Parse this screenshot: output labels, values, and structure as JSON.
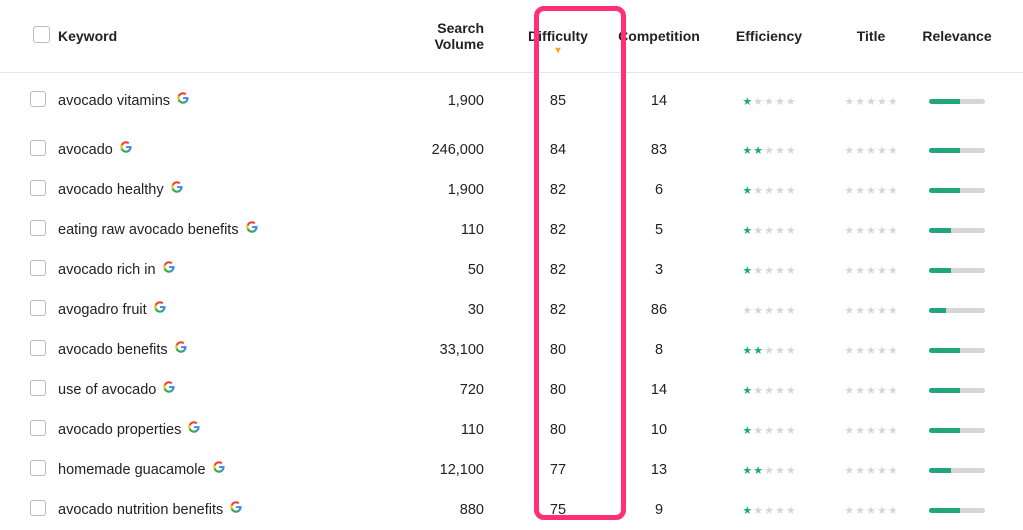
{
  "colors": {
    "accent_green": "#1fa67a",
    "highlight_pink": "#ff2f78",
    "star_off": "#d6d6d6"
  },
  "headers": {
    "keyword": "Keyword",
    "search_volume": "Search Volume",
    "difficulty": "Difficulty",
    "competition": "Competition",
    "efficiency": "Efficiency",
    "title": "Title",
    "relevance": "Relevance"
  },
  "sort": {
    "column": "difficulty",
    "direction": "desc",
    "caret": "▾"
  },
  "rows": [
    {
      "keyword": "avocado vitamins",
      "search_volume": "1,900",
      "difficulty": "85",
      "competition": "14",
      "efficiency_stars": 1,
      "title_stars": 0,
      "relevance_pct": 55
    },
    {
      "keyword": "avocado",
      "search_volume": "246,000",
      "difficulty": "84",
      "competition": "83",
      "efficiency_stars": 2,
      "title_stars": 0,
      "relevance_pct": 55
    },
    {
      "keyword": "avocado healthy",
      "search_volume": "1,900",
      "difficulty": "82",
      "competition": "6",
      "efficiency_stars": 1,
      "title_stars": 0,
      "relevance_pct": 55
    },
    {
      "keyword": "eating raw avocado benefits",
      "search_volume": "110",
      "difficulty": "82",
      "competition": "5",
      "efficiency_stars": 1,
      "title_stars": 0,
      "relevance_pct": 40
    },
    {
      "keyword": "avocado rich in",
      "search_volume": "50",
      "difficulty": "82",
      "competition": "3",
      "efficiency_stars": 1,
      "title_stars": 0,
      "relevance_pct": 40
    },
    {
      "keyword": "avogadro fruit",
      "search_volume": "30",
      "difficulty": "82",
      "competition": "86",
      "efficiency_stars": 0,
      "title_stars": 0,
      "relevance_pct": 30
    },
    {
      "keyword": "avocado benefits",
      "search_volume": "33,100",
      "difficulty": "80",
      "competition": "8",
      "efficiency_stars": 2,
      "title_stars": 0,
      "relevance_pct": 55
    },
    {
      "keyword": "use of avocado",
      "search_volume": "720",
      "difficulty": "80",
      "competition": "14",
      "efficiency_stars": 1,
      "title_stars": 0,
      "relevance_pct": 55
    },
    {
      "keyword": "avocado properties",
      "search_volume": "110",
      "difficulty": "80",
      "competition": "10",
      "efficiency_stars": 1,
      "title_stars": 0,
      "relevance_pct": 55
    },
    {
      "keyword": "homemade guacamole",
      "search_volume": "12,100",
      "difficulty": "77",
      "competition": "13",
      "efficiency_stars": 2,
      "title_stars": 0,
      "relevance_pct": 40
    },
    {
      "keyword": "avocado nutrition benefits",
      "search_volume": "880",
      "difficulty": "75",
      "competition": "9",
      "efficiency_stars": 1,
      "title_stars": 0,
      "relevance_pct": 55
    }
  ],
  "icons": {
    "google": "google-icon"
  }
}
